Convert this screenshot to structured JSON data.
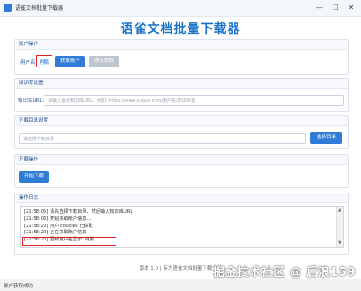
{
  "window": {
    "title": "语雀文档批量下载器",
    "minimize": "—",
    "maximize": "☐",
    "close": "✕"
  },
  "page_title": "语雀文档批量下载器",
  "account": {
    "section_title": "账户操作",
    "user_label": "用户名:",
    "user_value": "肖鹏",
    "get_button": "获取账户",
    "stop_button": "停止获取"
  },
  "knowledge": {
    "section_title": "知识库设置",
    "url_label": "知识库URL:",
    "url_placeholder": "请输入语雀知识库URL，例如: https://www.yuque.com/用户名/知识库名"
  },
  "download_dir": {
    "section_title": "下载目录设置",
    "placeholder": "请选择下载目录",
    "choose_button": "选择目录"
  },
  "download_ops": {
    "section_title": "下载操作",
    "start_button": "开始下载"
  },
  "log": {
    "section_title": "操作日志",
    "lines": [
      "[21:58:05] 请先选择下载目录、然后输入知识库URL",
      "[21:58:06] 开始获取账户信息...",
      "[21:58:20] 用户 cookies 已获取",
      "[21:58:20] 正在获取账户信息",
      "[21:58:20] 更新用户名显示: 肖鹏"
    ]
  },
  "footer": {
    "version_text": "版本 1.0 | 专为语雀文档批量下载设计"
  },
  "status": {
    "text": "账户获取成功"
  },
  "watermark": "掘金技术社区 @ 后浪159",
  "colors": {
    "accent": "#2f7bd6",
    "highlight": "#e02020",
    "disabled": "#bfc5cc"
  }
}
